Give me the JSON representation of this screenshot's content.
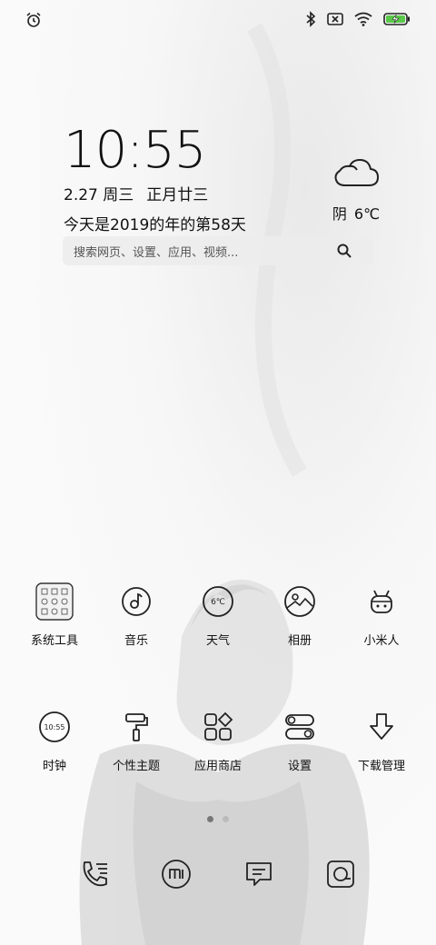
{
  "clock": {
    "time": "10:55",
    "date": "2.27 周三",
    "lunar": "正月廿三",
    "day_of_year": "今天是2019的年的第58天"
  },
  "weather": {
    "condition": "阴",
    "temp": "6℃",
    "icon": "cloud-icon"
  },
  "search": {
    "placeholder": "搜索网页、设置、应用、视频..."
  },
  "apps_row1": [
    {
      "label": "系统工具",
      "icon": "system-tools-folder-icon"
    },
    {
      "label": "音乐",
      "icon": "music-icon"
    },
    {
      "label": "天气",
      "icon": "weather-icon",
      "badge": "6℃"
    },
    {
      "label": "相册",
      "icon": "gallery-icon"
    },
    {
      "label": "小米人",
      "icon": "mi-bunny-icon"
    }
  ],
  "apps_row2": [
    {
      "label": "时钟",
      "icon": "clock-icon",
      "badge": "10:55"
    },
    {
      "label": "个性主题",
      "icon": "themes-icon"
    },
    {
      "label": "应用商店",
      "icon": "app-store-icon"
    },
    {
      "label": "设置",
      "icon": "settings-icon"
    },
    {
      "label": "下载管理",
      "icon": "downloads-icon"
    }
  ],
  "dock": [
    "phone-icon",
    "mi-browser-icon",
    "messages-icon",
    "camera-icon"
  ],
  "page_indicator": {
    "count": 2,
    "active": 0
  }
}
